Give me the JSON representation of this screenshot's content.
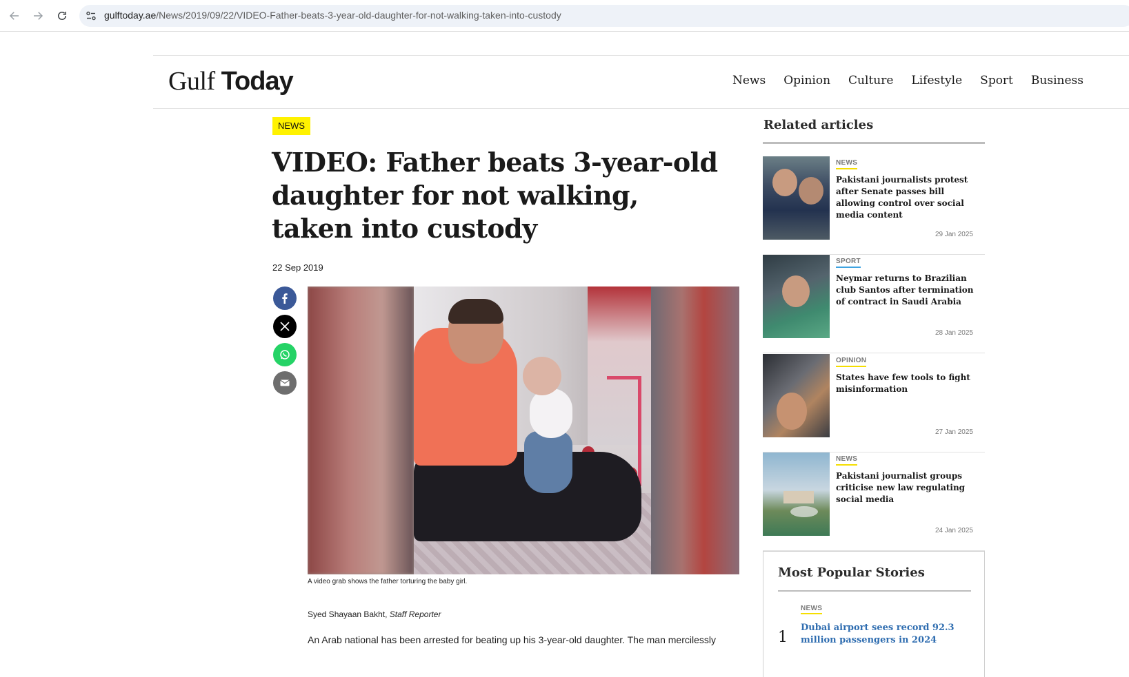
{
  "browser": {
    "url_host": "gulftoday.ae",
    "url_path": "/News/2019/09/22/VIDEO-Father-beats-3-year-old-daughter-for-not-walking-taken-into-custody"
  },
  "site": {
    "logo_part1": "Gulf ",
    "logo_part2": "Today",
    "nav": [
      "News",
      "Opinion",
      "Culture",
      "Lifestyle",
      "Sport",
      "Business"
    ]
  },
  "article": {
    "category": "NEWS",
    "headline": "VIDEO: Father beats 3-year-old daughter for not walking, taken into custody",
    "date": "22 Sep 2019",
    "caption": "A video grab shows the father torturing the baby girl.",
    "author": "Syed Shayaan Bakht, ",
    "author_role": "Staff Reporter",
    "body_first_line": "An Arab national has been arrested for beating up his 3-year-old daughter. The man mercilessly"
  },
  "share": {
    "icons": [
      "facebook-icon",
      "x-icon",
      "whatsapp-icon",
      "email-icon"
    ]
  },
  "related": {
    "title": "Related articles",
    "items": [
      {
        "category": "NEWS",
        "underline_color": "#f5de00",
        "headline": "Pakistani journalists protest after Senate passes bill allowing control over social media content",
        "date": "29 Jan 2025"
      },
      {
        "category": "SPORT",
        "underline_color": "#3fa3e0",
        "headline": "Neymar returns to Brazilian club Santos after termination of contract in Saudi Arabia",
        "date": "28 Jan 2025"
      },
      {
        "category": "OPINION",
        "underline_color": "#f5de00",
        "headline": "States have few tools to fight misinformation",
        "date": "27 Jan 2025"
      },
      {
        "category": "NEWS",
        "underline_color": "#f5de00",
        "headline": "Pakistani journalist groups criticise new law regulating social media",
        "date": "24 Jan 2025"
      }
    ]
  },
  "popular": {
    "title": "Most Popular Stories",
    "items": [
      {
        "rank": "1",
        "category": "NEWS",
        "headline": "Dubai airport sees record 92.3 million passengers in 2024"
      }
    ]
  },
  "colors": {
    "badge": "#fff200",
    "facebook": "#3b5998",
    "whatsapp": "#25d366",
    "popular_link": "#2f6db0"
  }
}
